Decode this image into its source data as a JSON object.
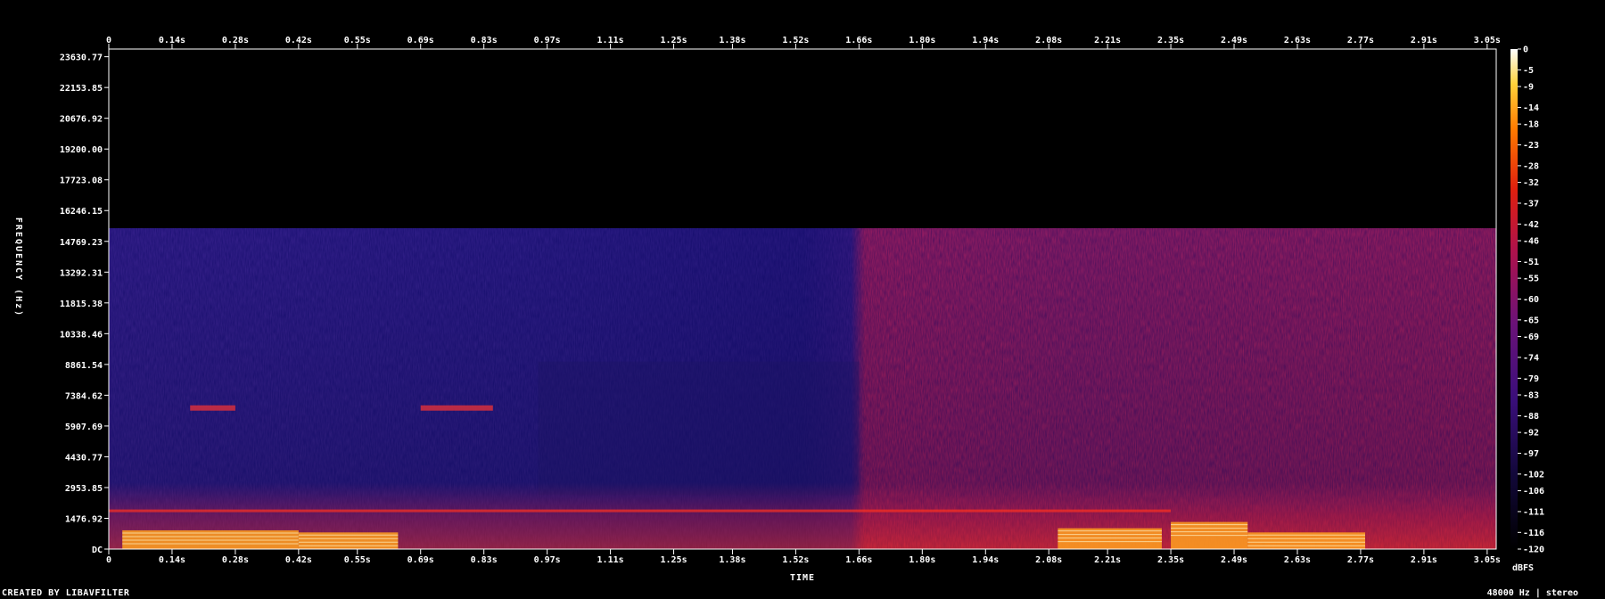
{
  "chart_data": {
    "type": "heatmap",
    "xlabel": "TIME",
    "ylabel": "FREQUENCY (Hz)",
    "x_ticks": [
      "0",
      "0.14s",
      "0.28s",
      "0.42s",
      "0.55s",
      "0.69s",
      "0.83s",
      "0.97s",
      "1.11s",
      "1.25s",
      "1.38s",
      "1.52s",
      "1.66s",
      "1.80s",
      "1.94s",
      "2.08s",
      "2.21s",
      "2.35s",
      "2.49s",
      "2.63s",
      "2.77s",
      "2.91s",
      "3.05s"
    ],
    "x_tick_values": [
      0,
      0.14,
      0.28,
      0.42,
      0.55,
      0.69,
      0.83,
      0.97,
      1.11,
      1.25,
      1.38,
      1.52,
      1.66,
      1.8,
      1.94,
      2.08,
      2.21,
      2.35,
      2.49,
      2.63,
      2.77,
      2.91,
      3.05
    ],
    "x_range": [
      0,
      3.07
    ],
    "y_ticks": [
      "23630.77",
      "22153.85",
      "20676.92",
      "19200.00",
      "17723.08",
      "16246.15",
      "14769.23",
      "13292.31",
      "11815.38",
      "10338.46",
      "8861.54",
      "7384.62",
      "5907.69",
      "4430.77",
      "2953.85",
      "1476.92",
      "DC"
    ],
    "y_tick_values": [
      23630.77,
      22153.85,
      20676.92,
      19200.0,
      17723.08,
      16246.15,
      14769.23,
      13292.31,
      11815.38,
      10338.46,
      8861.54,
      7384.62,
      5907.69,
      4430.77,
      2953.85,
      1476.92,
      0
    ],
    "y_range": [
      0,
      24000
    ],
    "colorbar_label": "dBFS",
    "colorbar_ticks": [
      "0",
      "-5",
      "-9",
      "-14",
      "-18",
      "-23",
      "-28",
      "-32",
      "-37",
      "-42",
      "-46",
      "-51",
      "-55",
      "-60",
      "-65",
      "-69",
      "-74",
      "-79",
      "-83",
      "-88",
      "-92",
      "-97",
      "-102",
      "-106",
      "-111",
      "-116",
      "-120"
    ],
    "colorbar_range": [
      -120,
      0
    ],
    "colors": {
      "background": "#000000",
      "low": "#000000",
      "mid_low": "#3a0e7a",
      "mid": "#b0124a",
      "high": "#ff6a00",
      "peak": "#ffffff"
    }
  },
  "footer": {
    "left": "CREATED BY LIBAVFILTER",
    "right": "48000 Hz | stereo"
  }
}
